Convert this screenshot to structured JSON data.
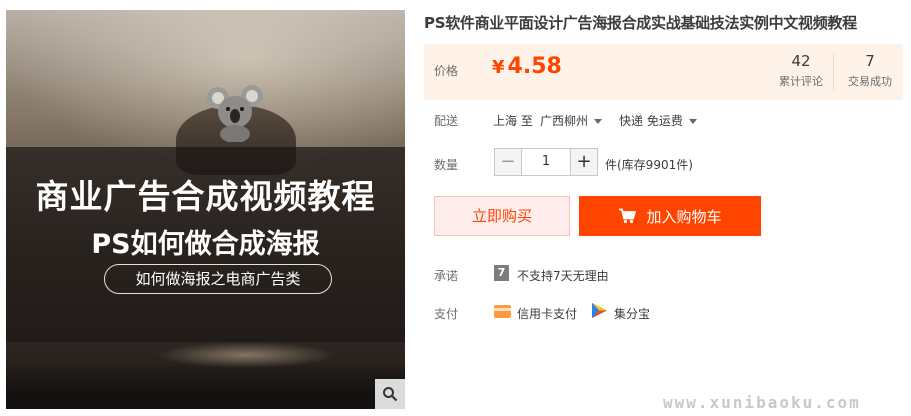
{
  "product": {
    "title": "PS软件商业平面设计广告海报合成实战基础技法实例中文视频教程",
    "image": {
      "headline": "商业广告合成视频教程",
      "subheadline": "PS如何做合成海报",
      "tagline": "如何做海报之电商广告类"
    }
  },
  "price": {
    "label": "价格",
    "currency": "¥",
    "value": "4.58"
  },
  "stats": {
    "reviews_count": "42",
    "reviews_label": "累计评论",
    "sales_count": "7",
    "sales_label": "交易成功"
  },
  "shipping": {
    "label": "配送",
    "from": "上海 至",
    "to": "广西柳州",
    "method": "快递 免运费"
  },
  "quantity": {
    "label": "数量",
    "minus": "−",
    "value": "1",
    "plus": "+",
    "stock_text": "件(库存9901件)"
  },
  "actions": {
    "buy_now": "立即购买",
    "add_to_cart": "加入购物车"
  },
  "promise": {
    "label": "承诺",
    "icon_text": "7",
    "text": "不支持7天无理由"
  },
  "payment": {
    "label": "支付",
    "methods": [
      "信用卡支付",
      "集分宝"
    ]
  },
  "watermark": "www.xunibaoku.com",
  "colors": {
    "accent": "#ff4400",
    "price_bg": "#fff2e8",
    "buy_now_bg": "#ffeded"
  }
}
